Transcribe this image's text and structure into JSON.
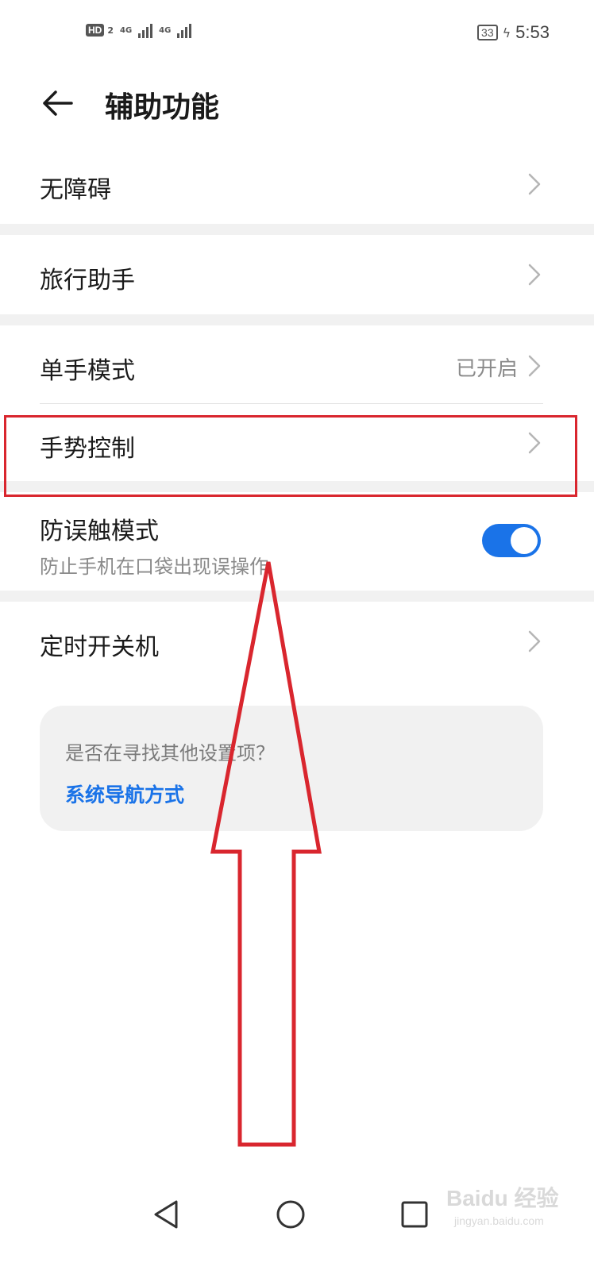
{
  "status_bar": {
    "hd_label": "HD",
    "sim_number": "2",
    "net_1": "4G",
    "net_2": "4G",
    "battery": "33",
    "time": "5:53"
  },
  "header": {
    "title": "辅助功能"
  },
  "rows": {
    "accessibility": "无障碍",
    "travel_assistant": "旅行助手",
    "one_hand_mode": "单手模式",
    "one_hand_mode_value": "已开启",
    "gesture_control": "手势控制",
    "accidental_touch": "防误触模式",
    "accidental_touch_desc": "防止手机在口袋出现误操作",
    "accidental_touch_on": true,
    "scheduled_power": "定时开关机"
  },
  "hint": {
    "question": "是否在寻找其他设置项？",
    "link": "系统导航方式"
  },
  "colors": {
    "accent": "#1a73e8",
    "annotation": "#d9262e",
    "band": "#f1f1f1"
  },
  "watermark": {
    "brand": "Baidu 经验",
    "site": "jingyan.baidu.com"
  }
}
